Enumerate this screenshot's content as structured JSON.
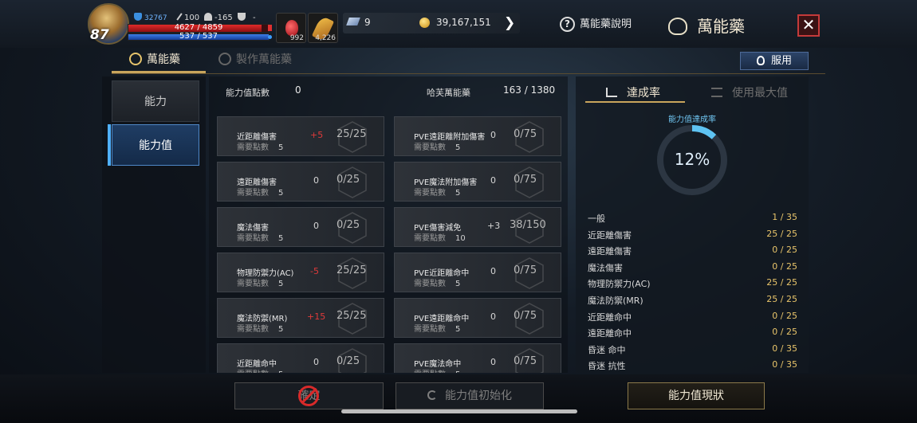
{
  "player": {
    "level": "87",
    "stat_1": "32767",
    "stat_2": "100",
    "stat_3": "-165",
    "stat_4": "-",
    "hp": "4627 / 4859",
    "mp": "537 / 537"
  },
  "quickslots": [
    {
      "icon": "gear-icon",
      "count": ""
    },
    {
      "icon": "red-potion-icon",
      "count": "992"
    },
    {
      "icon": "golden-feather-icon",
      "count": "4,226"
    }
  ],
  "currency": {
    "gems": "9",
    "gold": "39,167,151"
  },
  "header": {
    "help_label": "萬能藥說明",
    "title": "萬能藥",
    "close": "✕"
  },
  "main_tabs": [
    {
      "label": "萬能藥",
      "active": true
    },
    {
      "label": "製作萬能藥",
      "active": false
    }
  ],
  "use_button": "服用",
  "left_nav": [
    {
      "label": "能力",
      "active": false
    },
    {
      "label": "能力值",
      "active": true
    }
  ],
  "summary": {
    "points_label": "能力值點數",
    "points_value": "0",
    "elixir_label": "哈芙萬能藥",
    "elixir_value": "163 / 1380"
  },
  "cards": [
    {
      "name": "近距離傷害",
      "req": "需要點數",
      "req_val": "5",
      "bonus": "+5",
      "bonus_red": true,
      "progress": "25/25"
    },
    {
      "name": "PVE遠距離附加傷害",
      "req": "需要點數",
      "req_val": "5",
      "bonus": "0",
      "bonus_red": false,
      "progress": "0/75"
    },
    {
      "name": "遠距離傷害",
      "req": "需要點數",
      "req_val": "5",
      "bonus": "0",
      "bonus_red": false,
      "progress": "0/25"
    },
    {
      "name": "PVE魔法附加傷害",
      "req": "需要點數",
      "req_val": "5",
      "bonus": "0",
      "bonus_red": false,
      "progress": "0/75"
    },
    {
      "name": "魔法傷害",
      "req": "需要點數",
      "req_val": "5",
      "bonus": "0",
      "bonus_red": false,
      "progress": "0/25"
    },
    {
      "name": "PVE傷害減免",
      "req": "需要點數",
      "req_val": "10",
      "bonus": "+3",
      "bonus_red": false,
      "progress": "38/150"
    },
    {
      "name": "物理防禦力(AC)",
      "req": "需要點數",
      "req_val": "5",
      "bonus": "-5",
      "bonus_red": true,
      "progress": "25/25"
    },
    {
      "name": "PVE近距離命中",
      "req": "需要點數",
      "req_val": "5",
      "bonus": "0",
      "bonus_red": false,
      "progress": "0/75"
    },
    {
      "name": "魔法防禦(MR)",
      "req": "需要點數",
      "req_val": "5",
      "bonus": "+15",
      "bonus_red": true,
      "progress": "25/25"
    },
    {
      "name": "PVE遠距離命中",
      "req": "需要點數",
      "req_val": "5",
      "bonus": "0",
      "bonus_red": false,
      "progress": "0/75"
    },
    {
      "name": "近距離命中",
      "req": "需要點數",
      "req_val": "5",
      "bonus": "0",
      "bonus_red": false,
      "progress": "0/25"
    },
    {
      "name": "PVE魔法命中",
      "req": "需要點數",
      "req_val": "5",
      "bonus": "0",
      "bonus_red": false,
      "progress": "0/75"
    }
  ],
  "right_tabs": [
    {
      "label": "達成率",
      "active": true
    },
    {
      "label": "使用最大值",
      "active": false
    }
  ],
  "achievement": {
    "caption": "能力值達成率",
    "percent": "12%",
    "fraction": 0.12
  },
  "stats": [
    {
      "label": "一般",
      "value": "1 / 35",
      "highlight": true
    },
    {
      "label": "近距離傷害",
      "value": "25 / 25",
      "highlight": true
    },
    {
      "label": "遠距離傷害",
      "value": "0 / 25",
      "highlight": true
    },
    {
      "label": "魔法傷害",
      "value": "0 / 25",
      "highlight": true
    },
    {
      "label": "物理防禦力(AC)",
      "value": "25 / 25",
      "highlight": true
    },
    {
      "label": "魔法防禦(MR)",
      "value": "25 / 25",
      "highlight": true
    },
    {
      "label": "近距離命中",
      "value": "0 / 25",
      "highlight": true
    },
    {
      "label": "遠距離命中",
      "value": "0 / 25",
      "highlight": true
    },
    {
      "label": "昏迷 命中",
      "value": "0 / 35",
      "highlight": true
    },
    {
      "label": "昏迷 抗性",
      "value": "0 / 35",
      "highlight": true
    }
  ],
  "bottom": {
    "left_btn": "確定",
    "reset_btn": "能力值初始化",
    "status_btn": "能力值現狀"
  },
  "colors": {
    "accent_gold": "#c9a55c",
    "active_blue": "#4fb0ff",
    "bonus_red": "#e03a3a",
    "stat_gold": "#e8c46a",
    "ring_blue": "#5ec3f2"
  }
}
